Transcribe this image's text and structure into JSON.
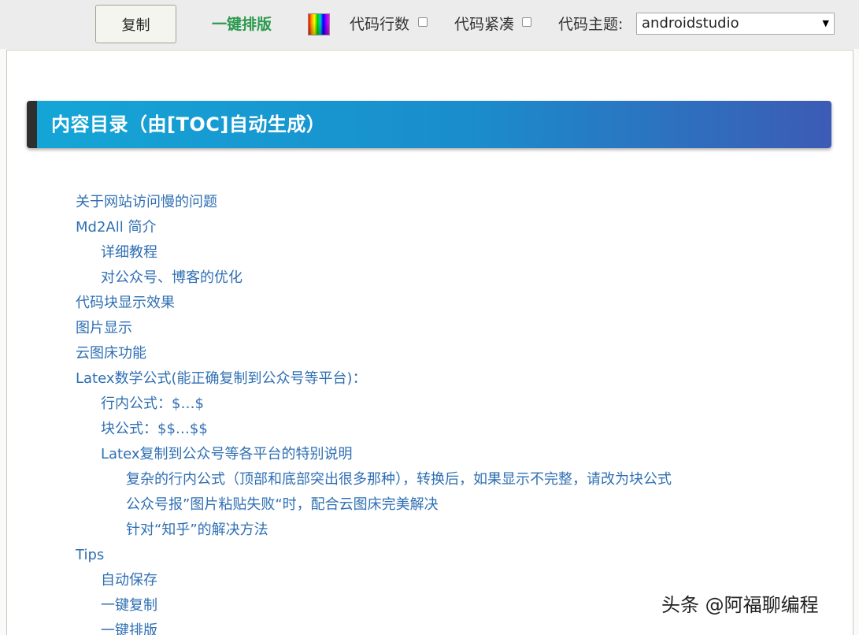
{
  "toolbar": {
    "copy_label": "复制",
    "format_label": "一键排版",
    "color_icon": "rainbow-color-swatch-icon",
    "line_numbers_label": "代码行数",
    "compact_label": "代码紧凑",
    "theme_label": "代码主题:",
    "theme_value": "androidstudio",
    "accent_color": "#2b9a4e"
  },
  "toc": {
    "title": "内容目录（由[TOC]自动生成）",
    "banner_colors": [
      "#14a6d6",
      "#3c5bb5"
    ],
    "link_color": "#2f6fb3",
    "items": [
      {
        "label": "关于网站访问慢的问题",
        "level": 1
      },
      {
        "label": "Md2All 简介",
        "level": 1
      },
      {
        "label": "详细教程",
        "level": 2
      },
      {
        "label": "对公众号、博客的优化",
        "level": 2
      },
      {
        "label": "代码块显示效果",
        "level": 1
      },
      {
        "label": "图片显示",
        "level": 1
      },
      {
        "label": "云图床功能",
        "level": 1
      },
      {
        "label": "Latex数学公式(能正确复制到公众号等平台)：",
        "level": 1
      },
      {
        "label": "行内公式：$…$",
        "level": 2
      },
      {
        "label": "块公式：$$…$$",
        "level": 2
      },
      {
        "label": "Latex复制到公众号等各平台的特别说明",
        "level": 2
      },
      {
        "label": "复杂的行内公式（顶部和底部突出很多那种），转换后，如果显示不完整，请改为块公式",
        "level": 3
      },
      {
        "label": "公众号报”图片粘贴失败“时，配合云图床完美解决",
        "level": 3
      },
      {
        "label": "针对“知乎”的解决方法",
        "level": 3
      },
      {
        "label": "Tips",
        "level": 1
      },
      {
        "label": "自动保存",
        "level": 2
      },
      {
        "label": "一键复制",
        "level": 2
      },
      {
        "label": "一键排版",
        "level": 2
      }
    ]
  },
  "watermark": "头条 @阿福聊编程"
}
